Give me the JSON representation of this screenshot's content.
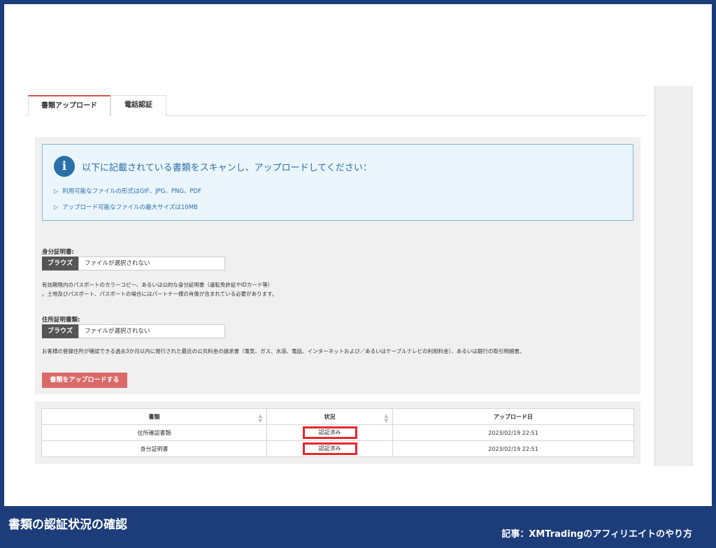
{
  "tabs": [
    {
      "label": "書類アップロード",
      "active": true
    },
    {
      "label": "電話認証",
      "active": false
    }
  ],
  "info_box": {
    "title": "以下に記載されている書類をスキャンし、アップロードしてください：",
    "items": [
      "利用可能なファイルの形式はGIF、JPG、PNG、PDF",
      "アップロード可能なファイルの最大サイズは10MB"
    ]
  },
  "id_document": {
    "label": "身分証明書:",
    "browse_label": "ブラウズ",
    "file_placeholder": "ファイルが選択されない",
    "description_lines": [
      "有効期限内のパスポートのカラーコピー、あるいは公的な身分証明書（運転免許証やIDカード等）",
      "。土地及びパスポート、パスポートの場合にはパートナー様の肖像が含まれている必要があります。"
    ]
  },
  "address_document": {
    "label": "住所証明書類:",
    "browse_label": "ブラウズ",
    "file_placeholder": "ファイルが選択されない",
    "description": "お客様の登録住所が確認できる過去3か月以内に発行された最近の公共料金の請求書（電気、ガス、水道、電話、インターネットおよび／あるいはケーブルテレビの利用料金）、あるいは銀行の取引明細書。"
  },
  "upload_button": "書類をアップロードする",
  "table": {
    "headers": [
      "書類",
      "状況",
      "アップロード日"
    ],
    "rows": [
      {
        "document": "住所確認書類",
        "status": "認証済み",
        "date": "2023/02/19 22:51"
      },
      {
        "document": "身分証明書",
        "status": "認証済み",
        "date": "2023/02/19 22:51"
      }
    ]
  },
  "footer": {
    "title": "書類の認証状況の確認",
    "article": "記事：XMTradingのアフィリエイトのやり方"
  },
  "colors": {
    "frame": "#1d3d7a",
    "info_accent": "#2a6fa8",
    "upload_button": "#d96a68",
    "highlight": "#e8282c",
    "active_tab": "#d9534f"
  },
  "icons": {
    "info": "info-icon",
    "arrow": "triangle-right-icon",
    "sort": "sort-icon"
  }
}
